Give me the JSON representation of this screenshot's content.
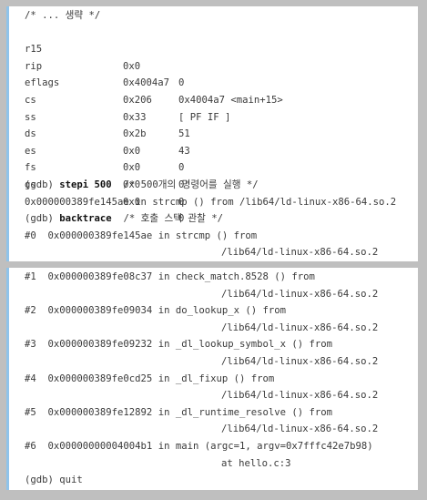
{
  "top": {
    "comment_line": "/* ... 생략 */",
    "registers": [
      {
        "name": "r15",
        "hex": "0x0",
        "val": "0"
      },
      {
        "name": "rip",
        "hex": "0x4004a7",
        "val": "0x4004a7 <main+15>"
      },
      {
        "name": "eflags",
        "hex": "0x206",
        "val": "[ PF IF ]"
      },
      {
        "name": "cs",
        "hex": "0x33",
        "val": "51"
      },
      {
        "name": "ss",
        "hex": "0x2b",
        "val": "43"
      },
      {
        "name": "ds",
        "hex": "0x0",
        "val": "0"
      },
      {
        "name": "es",
        "hex": "0x0",
        "val": "0"
      },
      {
        "name": "fs",
        "hex": "0x0",
        "val": "0"
      },
      {
        "name": "gs",
        "hex": "0x0",
        "val": "0"
      }
    ],
    "stepi": {
      "prompt": "(gdb) ",
      "cmd": "stepi 500",
      "comment": "  /* 500개의 명령어를 실행 */"
    },
    "stepi_result": "0x000000389fe145ae in strcmp () from /lib64/ld-linux-x86-64.so.2",
    "backtrace": {
      "prompt": "(gdb) ",
      "cmd": "backtrace",
      "comment": "  /* 호출 스택 관찰 */"
    },
    "frame0_a": "#0  0x000000389fe145ae in strcmp () from",
    "frame0_b": "/lib64/ld-linux-x86-64.so.2"
  },
  "bottom": {
    "frames": [
      {
        "a": "#1  0x000000389fe08c37 in check_match.8528 () from",
        "b": "/lib64/ld-linux-x86-64.so.2"
      },
      {
        "a": "#2  0x000000389fe09034 in do_lookup_x () from",
        "b": "/lib64/ld-linux-x86-64.so.2"
      },
      {
        "a": "#3  0x000000389fe09232 in _dl_lookup_symbol_x () from",
        "b": "/lib64/ld-linux-x86-64.so.2"
      },
      {
        "a": "#4  0x000000389fe0cd25 in _dl_fixup () from",
        "b": "/lib64/ld-linux-x86-64.so.2"
      },
      {
        "a": "#5  0x000000389fe12892 in _dl_runtime_resolve () from",
        "b": "/lib64/ld-linux-x86-64.so.2"
      },
      {
        "a": "#6  0x00000000004004b1 in main (argc=1, argv=0x7fffc42e7b98)",
        "b": "at hello.c:3"
      }
    ],
    "quit": "(gdb) quit"
  }
}
